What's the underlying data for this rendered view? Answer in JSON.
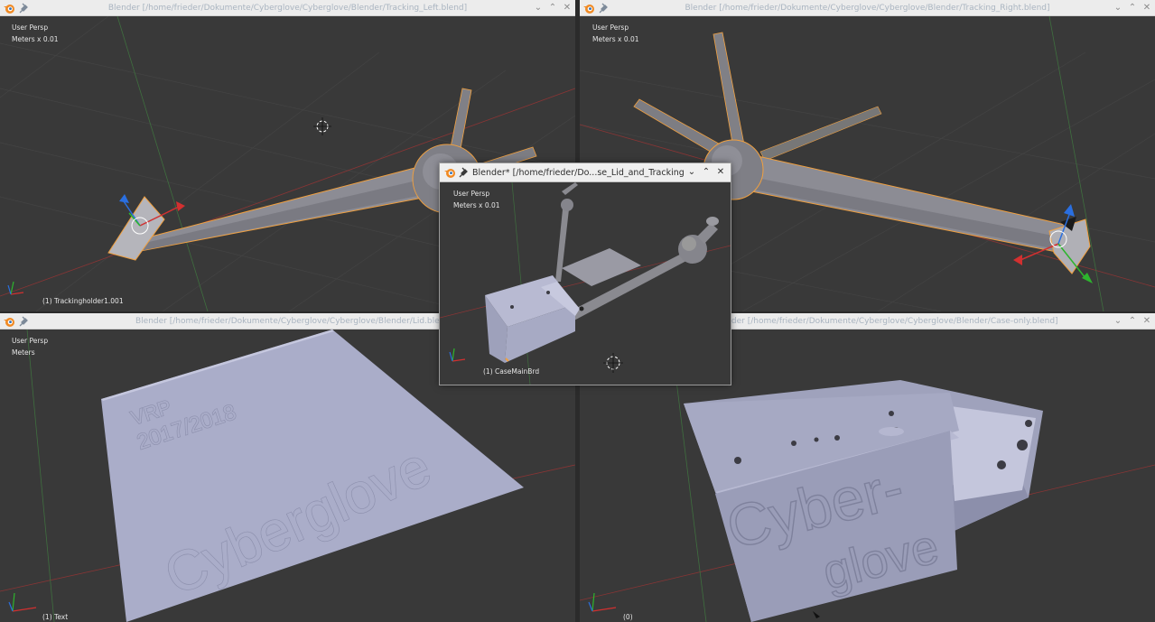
{
  "windows": {
    "top_left": {
      "title": "Blender [/home/frieder/Dokumente/Cyberglove/Cyberglove/Blender/Tracking_Left.blend]",
      "view_name": "User Persp",
      "units": "Meters x 0.01",
      "object": "(1) Trackingholder1.001"
    },
    "top_right": {
      "title": "Blender [/home/frieder/Dokumente/Cyberglove/Cyberglove/Blender/Tracking_Right.blend]",
      "view_name": "User Persp",
      "units": "Meters x 0.01"
    },
    "bottom_left": {
      "title": "Blender [/home/frieder/Dokumente/Cyberglove/Cyberglove/Blender/Lid.blend] +2",
      "view_name": "User Persp",
      "units": "Meters",
      "object": "(1) Text",
      "lid_year_line1": "VRP",
      "lid_year_line2": "2017/2018",
      "lid_brand": "Cyberglove"
    },
    "bottom_right": {
      "title": "Blender [/home/frieder/Dokumente/Cyberglove/Cyberglove/Blender/Case-only.blend]",
      "object": "(0)",
      "case_text_line1": "Cyber-",
      "case_text_line2": "glove"
    },
    "center": {
      "title": "Blender* [/home/frieder/Do...se_Lid_and_Tracking.blend]",
      "view_name": "User Persp",
      "units": "Meters x 0.01",
      "object": "(1) CaseMainBrd"
    }
  },
  "titlebar_buttons": {
    "minimize": "⌄",
    "maximize": "⌃",
    "close": "✕"
  },
  "colors": {
    "viewport_bg": "#393939",
    "mesh_gray": "#8c8c94",
    "mesh_lavender": "#a9acc6",
    "selection_outline": "#f0a040",
    "axis_x": "#d23030",
    "axis_y": "#2db52d",
    "axis_z": "#2a6fe0"
  }
}
